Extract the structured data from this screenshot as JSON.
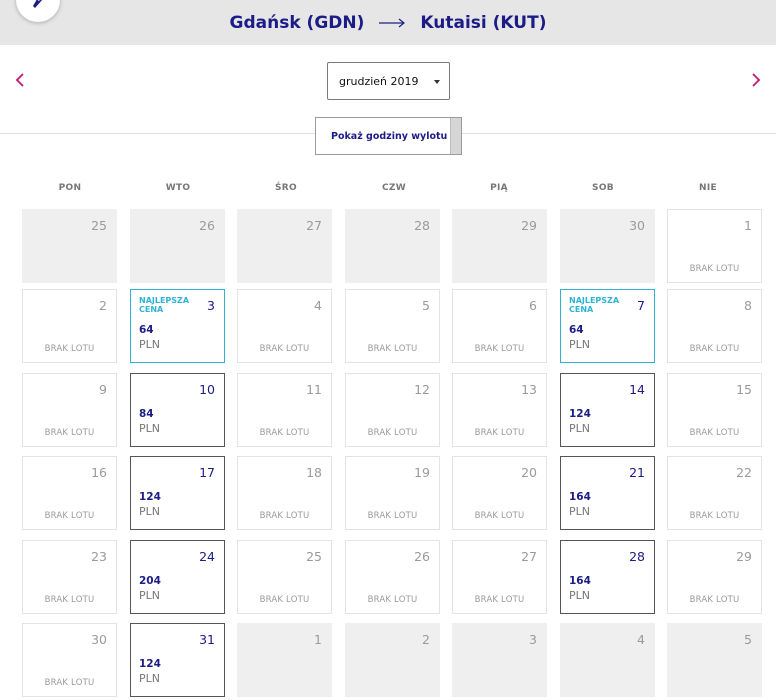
{
  "header": {
    "origin": "Gdańsk (GDN)",
    "destination": "Kutaisi (KUT)",
    "logo_icon": "airline-logo-icon",
    "route_arrow_icon": "long-arrow-right-icon"
  },
  "month_selector": {
    "value": "grudzień 2019",
    "prev_icon": "chevron-left-icon",
    "next_icon": "chevron-right-icon",
    "caret_icon": "caret-down-icon"
  },
  "toggle": {
    "label": "Pokaż godziny wylotu"
  },
  "weekdays": [
    "PON",
    "WTO",
    "ŚRO",
    "CZW",
    "PIĄ",
    "SOB",
    "NIE"
  ],
  "labels": {
    "no_flight": "BRAK LOTU",
    "best_price": "NAJLEPSZA CENA",
    "currency": "PLN"
  },
  "colors": {
    "brand": "#1c1c87",
    "accent": "#c8156b",
    "best_border": "#2fb3d4"
  },
  "calendar": {
    "weeks": [
      [
        {
          "day": "25",
          "type": "outside"
        },
        {
          "day": "26",
          "type": "outside"
        },
        {
          "day": "27",
          "type": "outside"
        },
        {
          "day": "28",
          "type": "outside"
        },
        {
          "day": "29",
          "type": "outside"
        },
        {
          "day": "30",
          "type": "outside"
        },
        {
          "day": "1",
          "type": "noflight"
        }
      ],
      [
        {
          "day": "2",
          "type": "noflight"
        },
        {
          "day": "3",
          "type": "best",
          "price": "64"
        },
        {
          "day": "4",
          "type": "noflight"
        },
        {
          "day": "5",
          "type": "noflight"
        },
        {
          "day": "6",
          "type": "noflight"
        },
        {
          "day": "7",
          "type": "best",
          "price": "64"
        },
        {
          "day": "8",
          "type": "noflight"
        }
      ],
      [
        {
          "day": "9",
          "type": "noflight"
        },
        {
          "day": "10",
          "type": "avail",
          "price": "84"
        },
        {
          "day": "11",
          "type": "noflight"
        },
        {
          "day": "12",
          "type": "noflight"
        },
        {
          "day": "13",
          "type": "noflight"
        },
        {
          "day": "14",
          "type": "avail",
          "price": "124"
        },
        {
          "day": "15",
          "type": "noflight"
        }
      ],
      [
        {
          "day": "16",
          "type": "noflight"
        },
        {
          "day": "17",
          "type": "avail",
          "price": "124"
        },
        {
          "day": "18",
          "type": "noflight"
        },
        {
          "day": "19",
          "type": "noflight"
        },
        {
          "day": "20",
          "type": "noflight"
        },
        {
          "day": "21",
          "type": "avail",
          "price": "164"
        },
        {
          "day": "22",
          "type": "noflight"
        }
      ],
      [
        {
          "day": "23",
          "type": "noflight"
        },
        {
          "day": "24",
          "type": "avail",
          "price": "204"
        },
        {
          "day": "25",
          "type": "noflight"
        },
        {
          "day": "26",
          "type": "noflight"
        },
        {
          "day": "27",
          "type": "noflight"
        },
        {
          "day": "28",
          "type": "avail",
          "price": "164"
        },
        {
          "day": "29",
          "type": "noflight"
        }
      ],
      [
        {
          "day": "30",
          "type": "noflight"
        },
        {
          "day": "31",
          "type": "avail",
          "price": "124"
        },
        {
          "day": "1",
          "type": "outside"
        },
        {
          "day": "2",
          "type": "outside"
        },
        {
          "day": "3",
          "type": "outside"
        },
        {
          "day": "4",
          "type": "outside"
        },
        {
          "day": "5",
          "type": "outside"
        }
      ]
    ]
  }
}
